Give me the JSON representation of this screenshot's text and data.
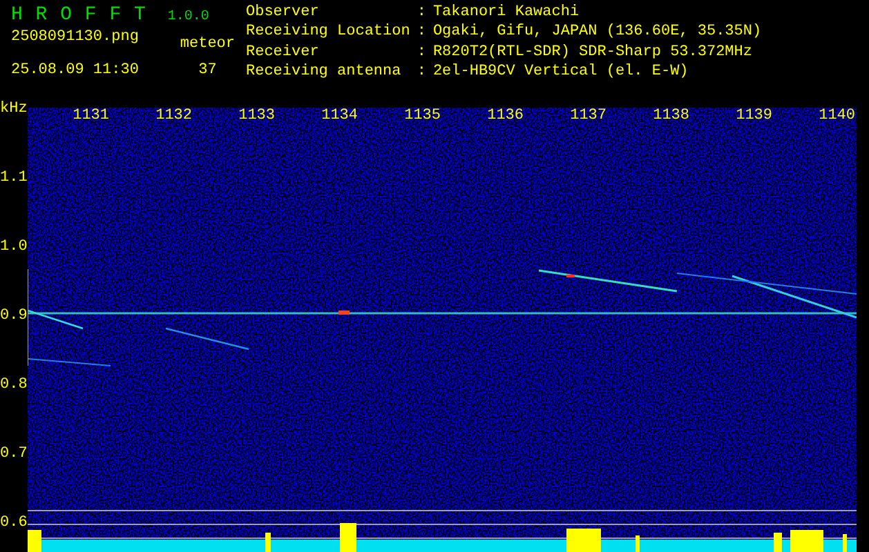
{
  "header": {
    "app_title": "H R O F F T",
    "version": "1.0.0",
    "filename": "2508091130.png",
    "datetime": "25.08.09 11:30",
    "count_label": "meteor",
    "count": "37"
  },
  "info": [
    {
      "label": "Observer",
      "separator": ":",
      "value": "Takanori Kawachi"
    },
    {
      "label": "Receiving Location",
      "separator": ":",
      "value": "Ogaki, Gifu, JAPAN (136.60E, 35.35N)"
    },
    {
      "label": "Receiver",
      "separator": ":",
      "value": "R820T2(RTL-SDR) SDR-Sharp 53.372MHz"
    },
    {
      "label": "Receiving antenna",
      "separator": ":",
      "value": "2el-HB9CV Vertical (el. E-W)"
    }
  ],
  "spectrogram": {
    "unit": "kHz",
    "x_labels": [
      "1131",
      "1132",
      "1133",
      "1134",
      "1135",
      "1136",
      "1137",
      "1138",
      "1139",
      "1140"
    ],
    "y_labels": [
      "1.1",
      "1.0",
      "0.9",
      "0.8",
      "0.7",
      "0.6"
    ]
  }
}
